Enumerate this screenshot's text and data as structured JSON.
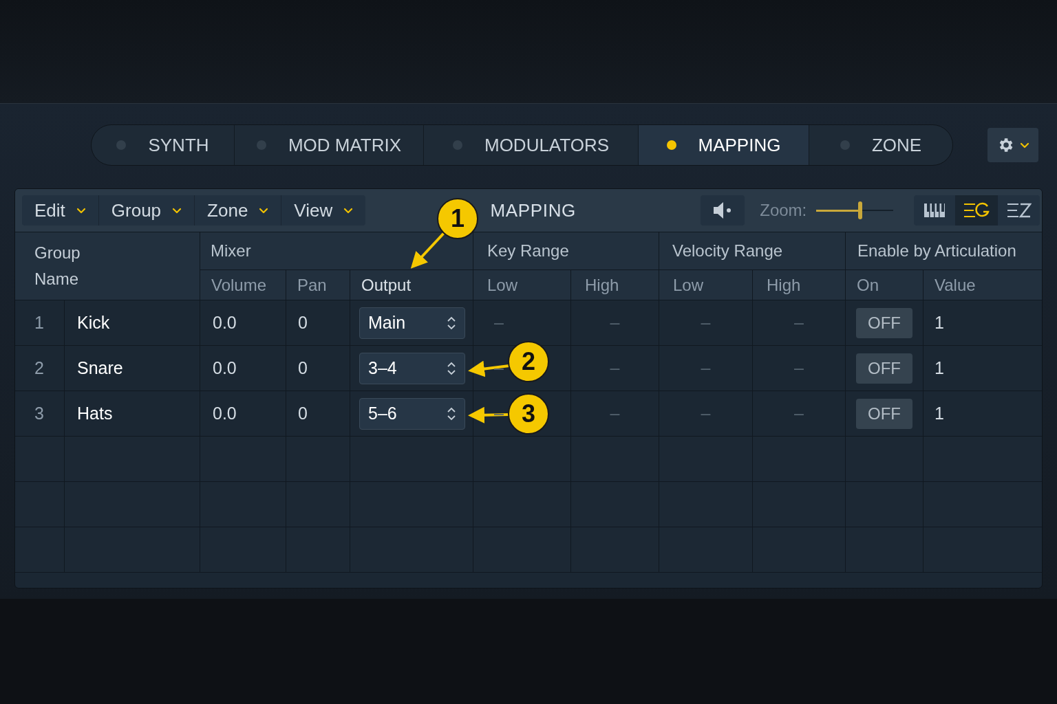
{
  "tabs": [
    {
      "label": "SYNTH",
      "selected": false
    },
    {
      "label": "MOD MATRIX",
      "selected": false
    },
    {
      "label": "MODULATORS",
      "selected": false
    },
    {
      "label": "MAPPING",
      "selected": true
    },
    {
      "label": "ZONE",
      "selected": false
    }
  ],
  "menus": [
    "Edit",
    "Group",
    "Zone",
    "View"
  ],
  "panel_title": "MAPPING",
  "zoom": {
    "label": "Zoom:",
    "level": 0.57
  },
  "view_buttons": [
    {
      "kind": "keyboard",
      "selected": false
    },
    {
      "kind": "groups",
      "selected": true
    },
    {
      "kind": "zones",
      "selected": false
    }
  ],
  "header": {
    "group_name": "Group Name",
    "mixer": "Mixer",
    "mixer_columns": [
      "Volume",
      "Pan",
      "Output"
    ],
    "key_range": "Key Range",
    "key_columns": [
      "Low",
      "High"
    ],
    "velocity_range": "Velocity Range",
    "velocity_columns": [
      "Low",
      "High"
    ],
    "articulation": "Enable by Articulation",
    "articulation_columns": [
      "On",
      "Value"
    ]
  },
  "rows": [
    {
      "index": "1",
      "name": "Kick",
      "volume": "0.0",
      "pan": "0",
      "output": "Main",
      "key_low": "–",
      "key_high": "–",
      "vel_low": "–",
      "vel_high": "–",
      "on": false,
      "on_label": "OFF",
      "value": "1"
    },
    {
      "index": "2",
      "name": "Snare",
      "volume": "0.0",
      "pan": "0",
      "output": "3–4",
      "key_low": "–",
      "key_high": "–",
      "vel_low": "–",
      "vel_high": "–",
      "on": false,
      "on_label": "OFF",
      "value": "1"
    },
    {
      "index": "3",
      "name": "Hats",
      "volume": "0.0",
      "pan": "0",
      "output": "5–6",
      "key_low": "–",
      "key_high": "–",
      "vel_low": "–",
      "vel_high": "–",
      "on": false,
      "on_label": "OFF",
      "value": "1"
    }
  ],
  "callouts": [
    "1",
    "2",
    "3"
  ]
}
